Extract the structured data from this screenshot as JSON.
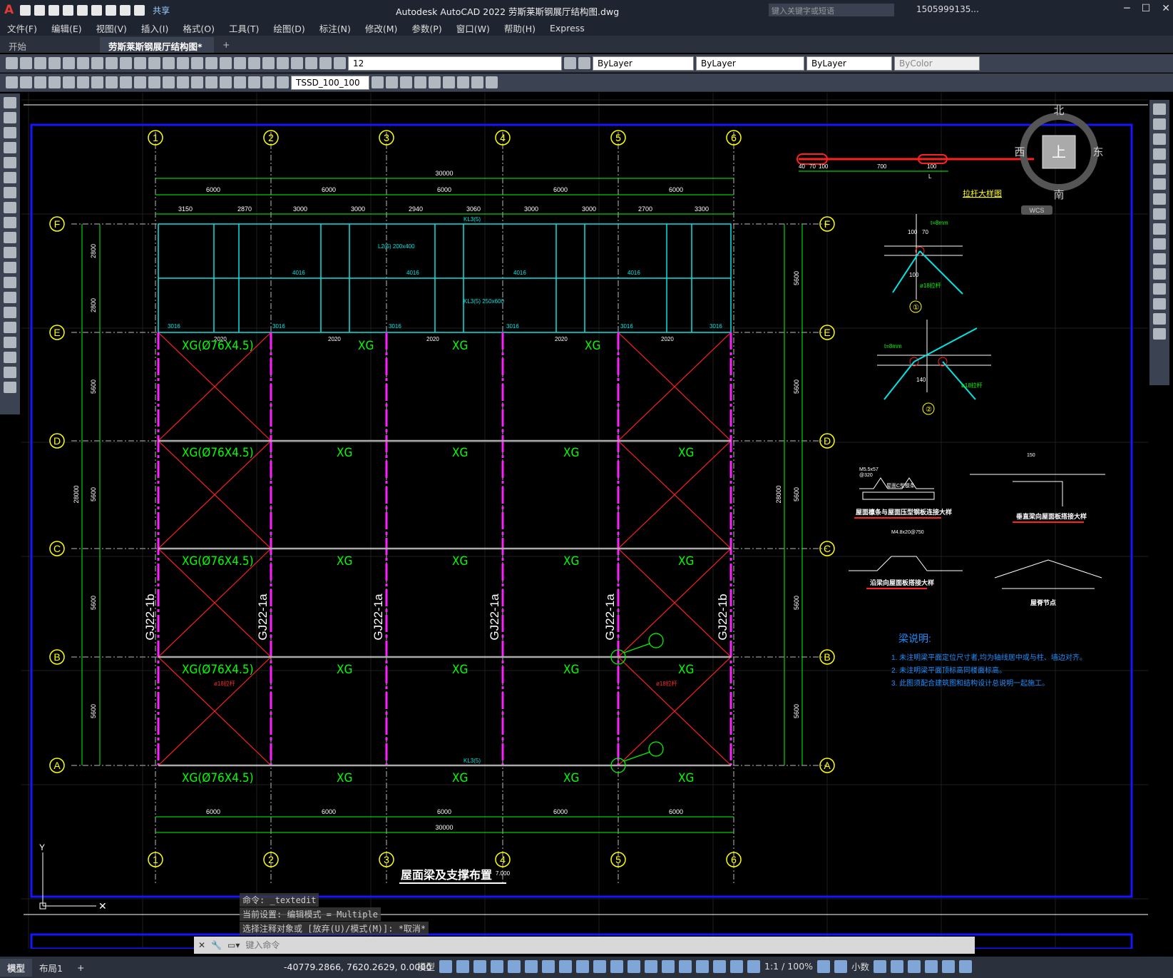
{
  "app": {
    "title": "Autodesk AutoCAD 2022    劳斯莱斯钢展厅结构图.dwg",
    "share_label": "共享",
    "search_placeholder": "键入关键字或短语",
    "user": "1505999135...",
    "logo": "A"
  },
  "menu": [
    "文件(F)",
    "编辑(E)",
    "视图(V)",
    "插入(I)",
    "格式(O)",
    "工具(T)",
    "绘图(D)",
    "标注(N)",
    "修改(M)",
    "参数(P)",
    "窗口(W)",
    "帮助(H)",
    "Express"
  ],
  "tabs": {
    "start": "开始",
    "drawing": "劳斯莱斯钢展厅结构图*"
  },
  "toolbar": {
    "layer": "12",
    "color": "ByLayer",
    "linetype": "ByLayer",
    "lineweight": "ByLayer",
    "plotstyle": "ByColor",
    "dimstyle": "TSSD_100_100"
  },
  "viewcube": {
    "north": "北",
    "south": "南",
    "east": "东",
    "west": "西",
    "top": "上",
    "wcs": "WCS"
  },
  "drawing": {
    "axes_x": [
      "1",
      "2",
      "3",
      "4",
      "5",
      "6"
    ],
    "axes_y": [
      "F",
      "E",
      "D",
      "C",
      "B",
      "A"
    ],
    "total": "30000",
    "bays": [
      "6000",
      "6000",
      "6000",
      "6000",
      "6000"
    ],
    "sub_dims": [
      "3150",
      "2870",
      "3000",
      "3000",
      "2940",
      "3060",
      "3000",
      "3000",
      "2700",
      "3300"
    ],
    "v_total": "28000",
    "v_bays": [
      "5600",
      "5600",
      "5600",
      "5600",
      "5600"
    ],
    "v_top": [
      "2800",
      "2800"
    ],
    "brace": "XG(Ø76X4.5)",
    "xg": "XG",
    "truss": [
      "GJ22-1b",
      "GJ22-1a",
      "GJ22-1a",
      "GJ22-1a",
      "GJ22-1a",
      "GJ22-1b"
    ],
    "kl3": "KL3(5)",
    "kl3b": "KL3(5) 250x600",
    "l2": "L2(5) 200x400",
    "dim2020": "2020",
    "dim3016": "3016",
    "dim4016": "4016",
    "rod": "ø18拉杆",
    "plan_title": "屋面梁及支撑布置",
    "scale": "7.000",
    "detail_rod": "拉杆大样图",
    "detail_roof1": "屋面檩条与屋面压型钢板连接大样",
    "detail_roof2": "垂直梁向屋面板搭接大样",
    "detail_roof3": "沿梁向屋面板搭接大样",
    "detail_ridge": "屋脊节点",
    "notes_title": "梁说明:",
    "notes": [
      "1. 未注明梁平面定位尺寸者,均为轴线居中或与柱、墙边对齐。",
      "2. 未注明梁平面顶标高同楼面标高。",
      "3. 此图须配合建筑图和结构设计总说明一起施工。"
    ],
    "d1": "①",
    "d2": "②",
    "t8": "t=8mm",
    "d100": "100",
    "d70": "70",
    "d700": "700",
    "d140": "140",
    "d40": "40",
    "dl": "L",
    "m55": "M5.5x57",
    "c320": "@320",
    "roofc": "屋面C型檩条",
    "d150": "150",
    "m48": "M4.8x20@750"
  },
  "command": {
    "history": [
      "命令: _textedit",
      "当前设置: 编辑模式 = Multiple",
      "选择注释对象或 [放弃(U)/模式(M)]: *取消*"
    ],
    "placeholder": "键入命令"
  },
  "status": {
    "model_tab": "模型",
    "layout_tab": "布局1",
    "coords": "-40779.2866, 7620.2629, 0.0000",
    "mode": "模型",
    "scale": "1:1 / 100%",
    "units": "小数"
  }
}
